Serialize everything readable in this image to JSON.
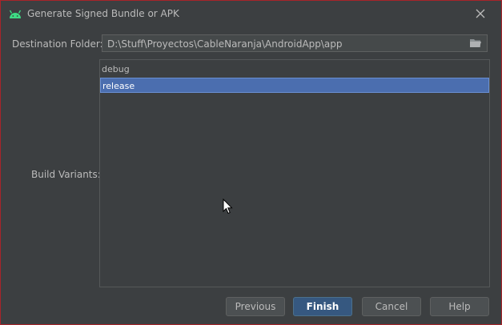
{
  "window": {
    "title": "Generate Signed Bundle or APK",
    "app_icon": "android-icon",
    "close_icon": "close-icon",
    "border_color": "#a8242a"
  },
  "destination": {
    "label": "Destination Folder:",
    "value": "D:\\Stuff\\Proyectos\\CableNaranja\\AndroidApp\\app",
    "browse_icon": "folder-icon"
  },
  "build_variants": {
    "label": "Build Variants:",
    "items": [
      {
        "label": "debug",
        "selected": false
      },
      {
        "label": "release",
        "selected": true
      }
    ],
    "selection_color": "#4b6eaf"
  },
  "buttons": {
    "previous": "Previous",
    "finish": "Finish",
    "cancel": "Cancel",
    "help": "Help"
  }
}
